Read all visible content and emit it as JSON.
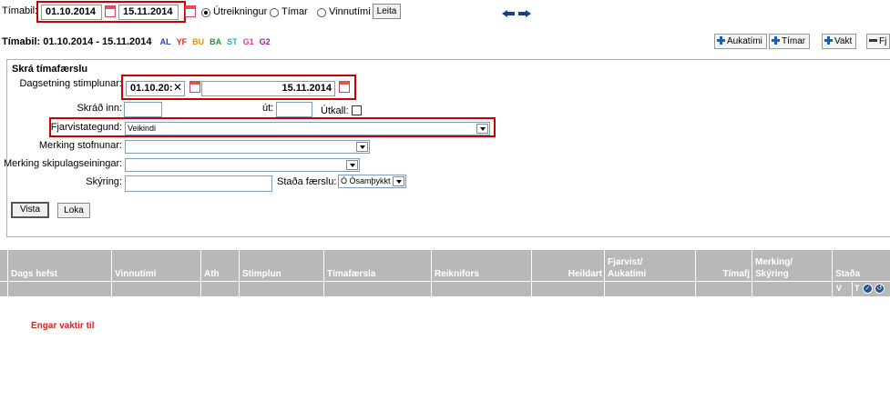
{
  "toolbar": {
    "timabil_label": "Tímabil:",
    "date_from": "01.10.2014",
    "date_to": "15.11.2014",
    "radio_options": [
      "Útreikningur",
      "Tímar",
      "Vinnutími"
    ],
    "selected_radio": "Útreikningur",
    "search_button": "Leita"
  },
  "period_title": {
    "text": "Tímabil: 01.10.2014 - 15.11.2014",
    "tags": [
      {
        "label": "AL",
        "color": "#1f3fbf"
      },
      {
        "label": "YF",
        "color": "#e0201a"
      },
      {
        "label": "BU",
        "color": "#e09020"
      },
      {
        "label": "BA",
        "color": "#2e8b3a"
      },
      {
        "label": "ST",
        "color": "#20b0c0"
      },
      {
        "label": "G1",
        "color": "#e040a0"
      },
      {
        "label": "G2",
        "color": "#8a2b8a"
      }
    ]
  },
  "action_buttons": [
    "Aukatími",
    "Tímar",
    "Vakt",
    "Fj"
  ],
  "form": {
    "title": "Skrá tímafærslu",
    "stimplun_label": "Dagsetning stimplunar:",
    "stimplun_from": "01.10.20:",
    "stimplun_to": "15.11.2014",
    "skrad_inn_label": "Skráð inn:",
    "ut_label": "út:",
    "utkall_label": "Útkall:",
    "fjarvist_label": "Fjarvistategund:",
    "fjarvist_value": "Veikindi",
    "stofnunar_label": "Merking stofnunar:",
    "skipulag_label": "Merking skipulagseiningar:",
    "skyring_label": "Skýring:",
    "stada_label": "Staða færslu:",
    "stada_value": "Ó Ósamþykkt",
    "vista_button": "Vista",
    "loka_button": "Loka"
  },
  "table": {
    "headers": [
      "Dags hefst",
      "Vinnutími",
      "Ath",
      "Stimplun",
      "Tímafærsla",
      "Reiknifors",
      "Heildart",
      "Fjarvist/",
      "Aukatími",
      "Tímafj",
      "Merking/",
      "Skýring",
      "Staða"
    ],
    "sub_labels": [
      "V",
      "T"
    ]
  },
  "empty_message": "Engar vaktir til"
}
